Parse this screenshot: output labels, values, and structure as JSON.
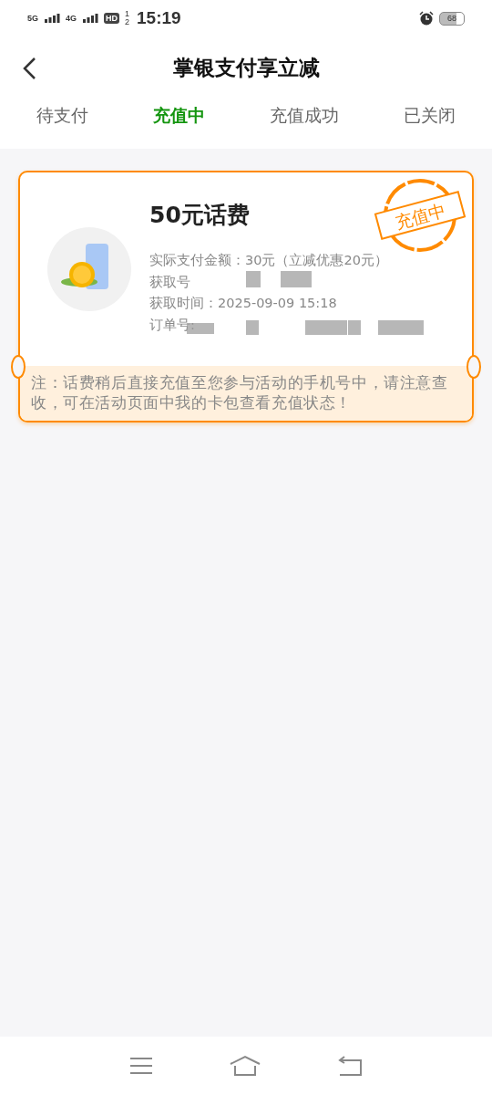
{
  "status_bar": {
    "network_1": "5G",
    "network_2": "4G",
    "hd": "HD",
    "hd_sub": "1",
    "hd_sub2": "2",
    "time": "15:19",
    "battery": "68"
  },
  "header": {
    "title": "掌银支付享立减"
  },
  "tabs": [
    {
      "label": "待支付",
      "selected": false
    },
    {
      "label": "充值中",
      "selected": true
    },
    {
      "label": "充值成功",
      "selected": false
    },
    {
      "label": "已关闭",
      "selected": false
    }
  ],
  "order": {
    "title": "50元话费",
    "stamp": "充值中",
    "lines": [
      "实际支付金额：30元（立减优惠20元）",
      "获取号",
      "获取时间：2025-09-09 15:18",
      "订单号:"
    ],
    "note": "注：话费稍后直接充值至您参与活动的手机号中，请注意查收，可在活动页面中我的卡包查看充值状态！"
  }
}
